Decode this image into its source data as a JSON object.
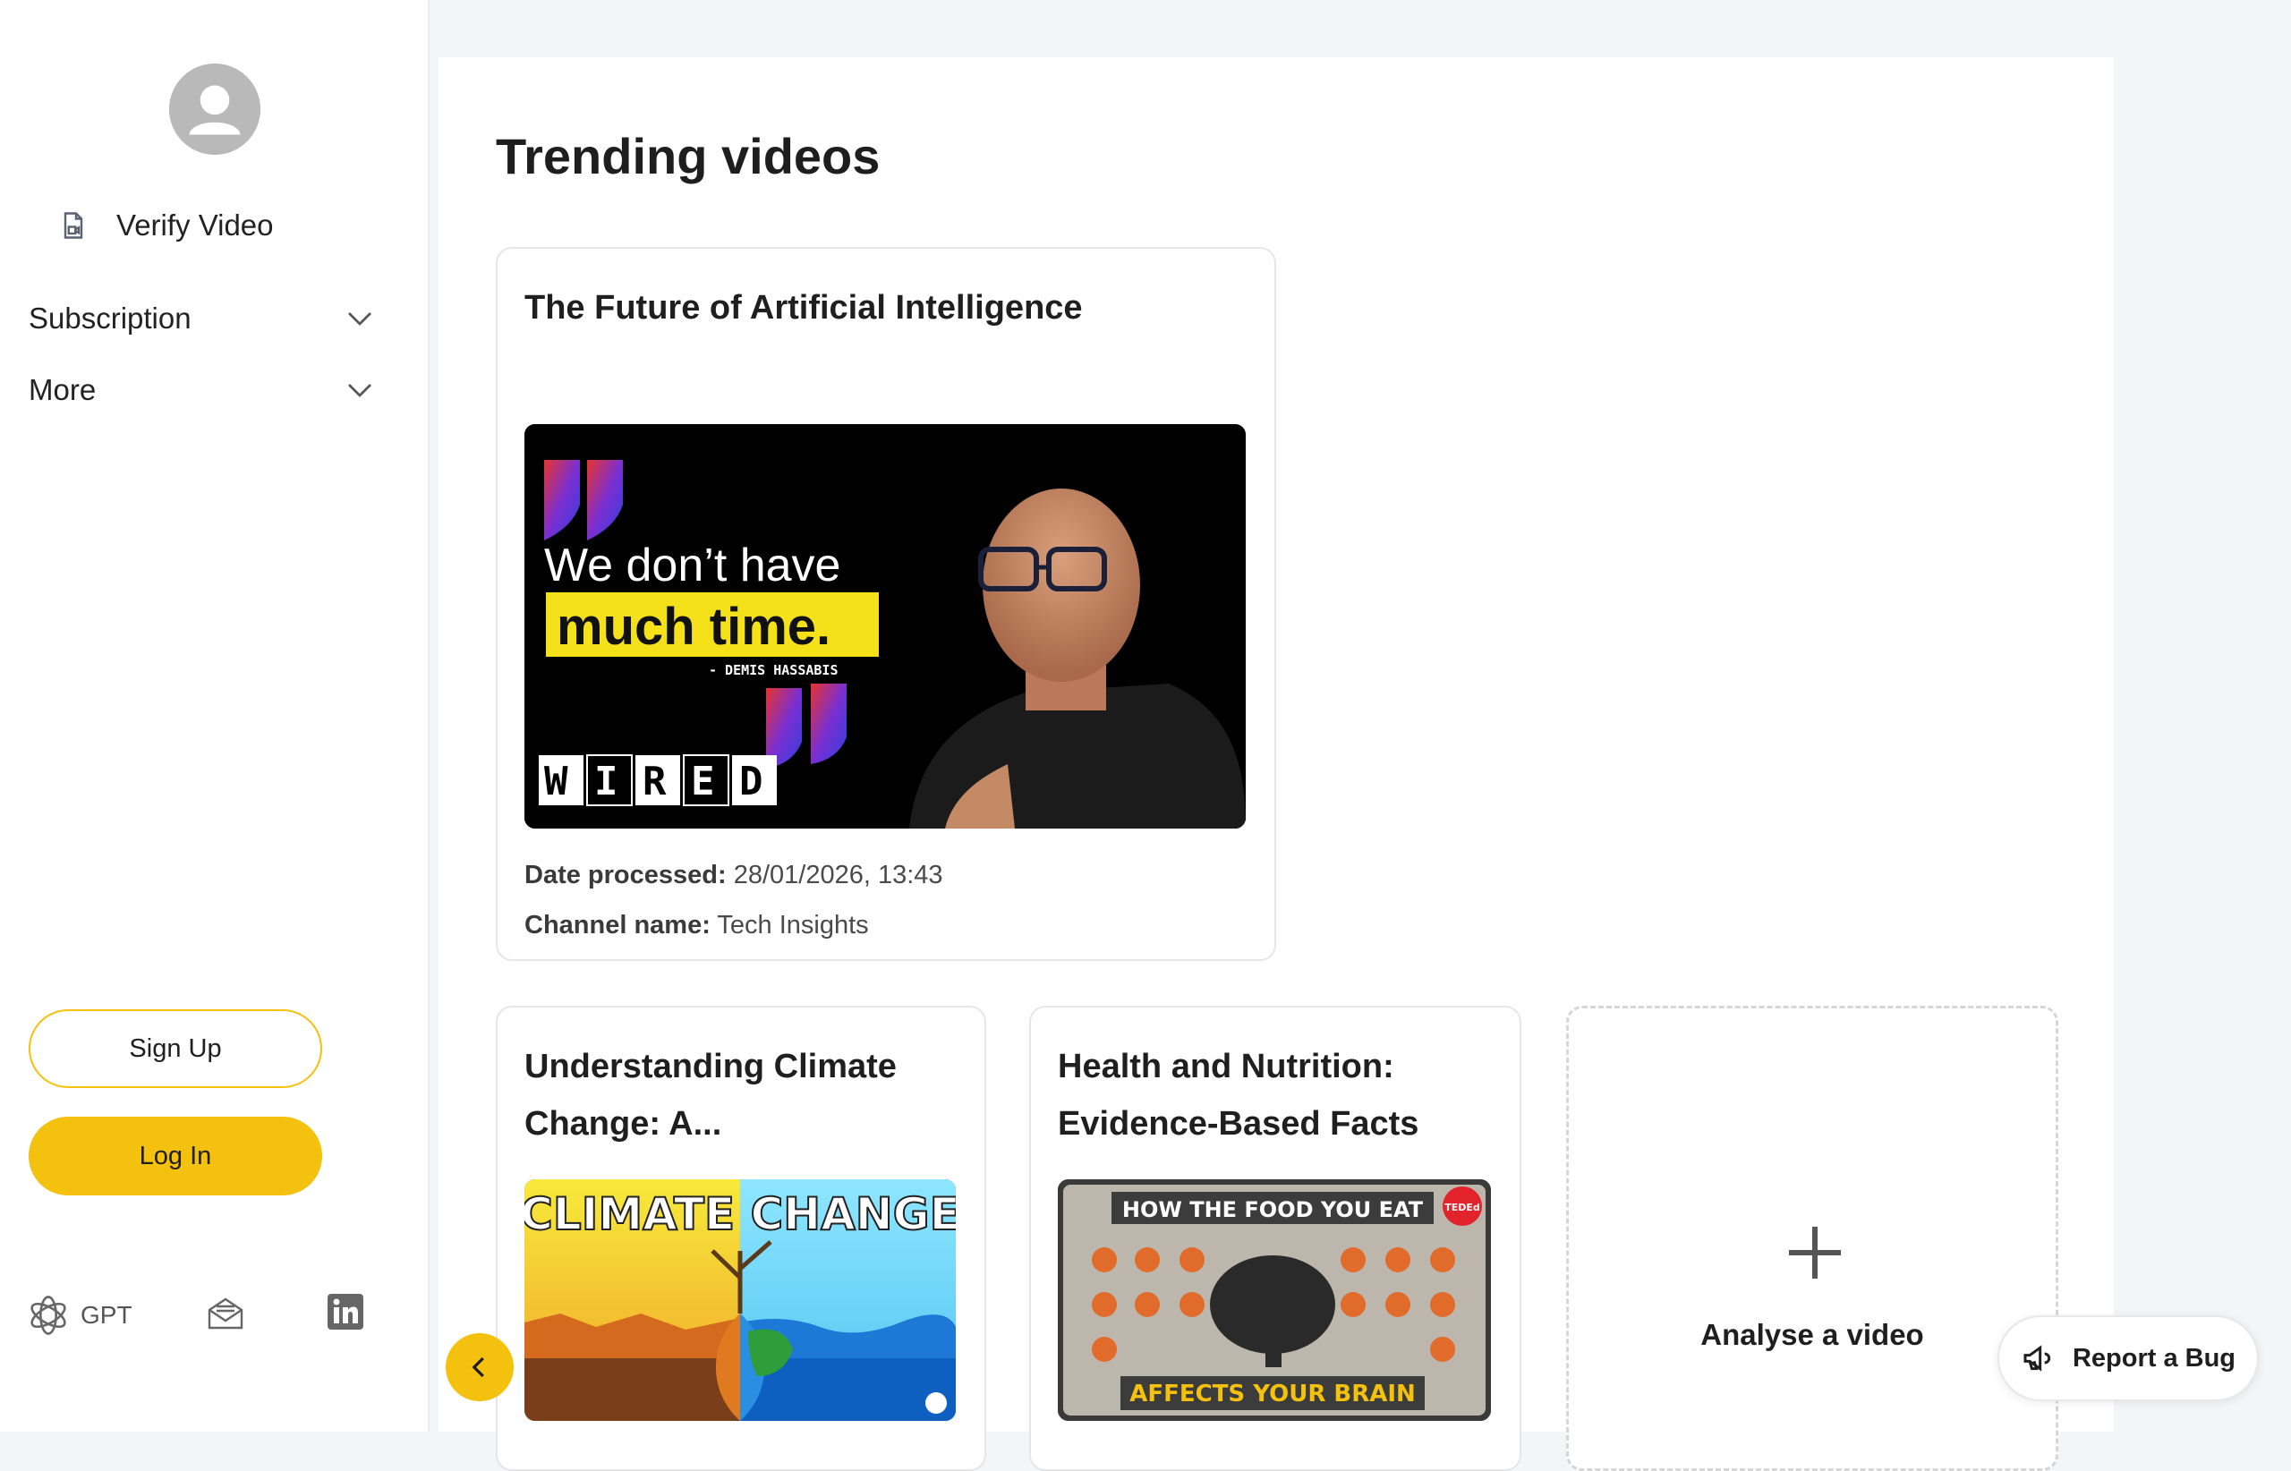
{
  "sidebar": {
    "verify_label": "Verify Video",
    "menu": [
      {
        "label": "Subscription"
      },
      {
        "label": "More"
      }
    ],
    "signup_label": "Sign Up",
    "login_label": "Log In",
    "footer": {
      "gpt_label": "GPT"
    }
  },
  "main": {
    "title": "Trending videos",
    "featured": {
      "title": "The Future of Artificial Intelligence",
      "thumbnail": {
        "quote_line1": "We don’t have",
        "quote_line2": "much time.",
        "attribution": "- DEMIS HASSABIS",
        "logo": "WIRED"
      },
      "date_label": "Date processed:",
      "date_value": "28/01/2026, 13:43",
      "channel_label": "Channel name:",
      "channel_value": "Tech Insights"
    },
    "videos": [
      {
        "title_line1": "Understanding Climate",
        "title_line2": "Change: A...",
        "thumbnail": {
          "text": "CLIMATE CHANGE"
        }
      },
      {
        "title_line1": "Health and Nutrition:",
        "title_line2": "Evidence-Based Facts",
        "thumbnail": {
          "top": "HOW THE FOOD YOU EAT",
          "bottom": "AFFECTS YOUR BRAIN",
          "badge": "TEDEd"
        }
      }
    ],
    "add_label": "Analyse a video"
  },
  "report_bug_label": "Report a Bug",
  "colors": {
    "accent": "#f5c10f",
    "background": "#f4f5f7"
  }
}
